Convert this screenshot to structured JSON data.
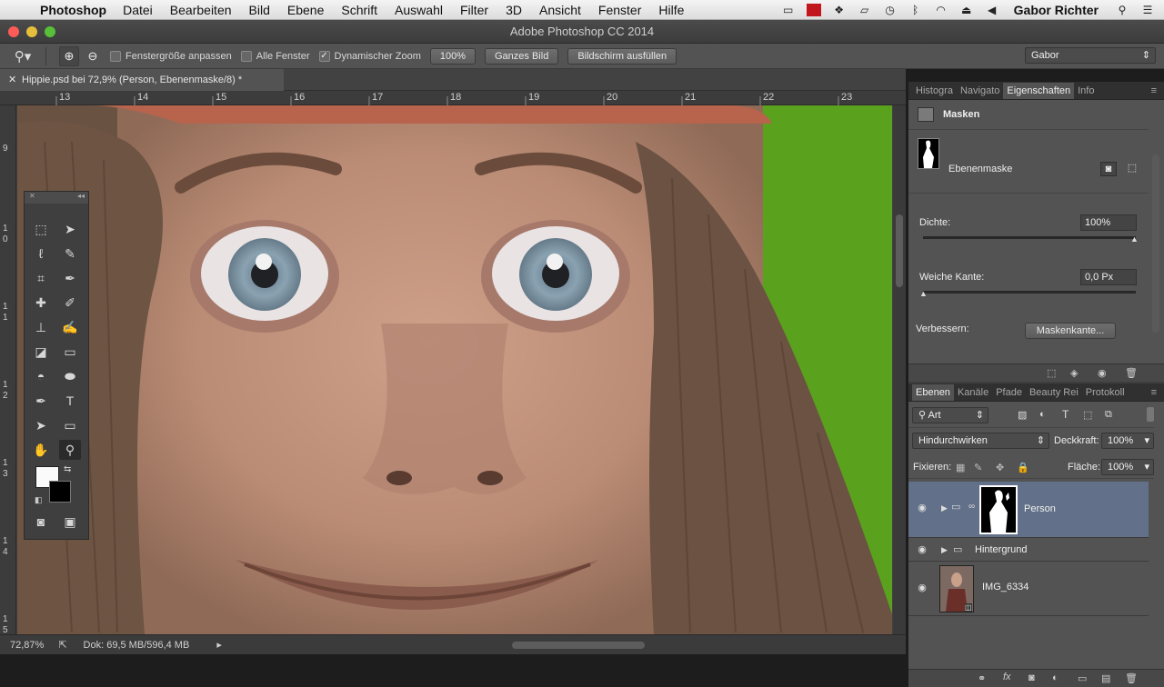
{
  "menubar": {
    "app": "Photoshop",
    "items": [
      "Datei",
      "Bearbeiten",
      "Bild",
      "Ebene",
      "Schrift",
      "Auswahl",
      "Filter",
      "3D",
      "Ansicht",
      "Fenster",
      "Hilfe"
    ],
    "user": "Gabor Richter"
  },
  "window": {
    "title": "Adobe Photoshop CC 2014"
  },
  "options": {
    "fit_window": "Fenstergröße anpassen",
    "all_windows": "Alle Fenster",
    "scrubby_zoom": "Dynamischer Zoom",
    "zoom_100": "100%",
    "fit_screen": "Ganzes Bild",
    "fill_screen": "Bildschirm ausfüllen",
    "workspace": "Gabor"
  },
  "document": {
    "tab": "Hippie.psd bei 72,9% (Person, Ebenenmaske/8) *",
    "ruler_h": [
      "13",
      "14",
      "15",
      "16",
      "17",
      "18",
      "19",
      "20",
      "21",
      "22",
      "23"
    ],
    "ruler_v": [
      "9",
      "1",
      "0",
      "1",
      "1",
      "1",
      "2",
      "1",
      "3",
      "1",
      "4",
      "1",
      "5"
    ]
  },
  "status": {
    "zoom": "72,87%",
    "doc_size": "Dok: 69,5 MB/596,4 MB"
  },
  "properties": {
    "tabs": [
      "Histogra",
      "Navigato",
      "Eigenschaften",
      "Info"
    ],
    "section": "Masken",
    "mask_label": "Ebenenmaske",
    "density_label": "Dichte:",
    "density_value": "100%",
    "density_level": 1.0,
    "feather_label": "Weiche Kante:",
    "feather_value": "0,0 Px",
    "feather_level": 0.0,
    "refine_label": "Verbessern:",
    "refine_button": "Maskenkante..."
  },
  "layers": {
    "tabs": [
      "Ebenen",
      "Kanäle",
      "Pfade",
      "Beauty Rei",
      "Protokoll"
    ],
    "filter_type": "Art",
    "blend_mode": "Hindurchwirken",
    "opacity_label": "Deckkraft:",
    "opacity_value": "100%",
    "lock_label": "Fixieren:",
    "fill_label": "Fläche:",
    "fill_value": "100%",
    "items": [
      {
        "name": "Person"
      },
      {
        "name": "Hintergrund"
      },
      {
        "name": "IMG_6334"
      }
    ]
  },
  "colors": {
    "selection": "#627189",
    "panel": "#535353",
    "background_green": "#5aa11e"
  }
}
